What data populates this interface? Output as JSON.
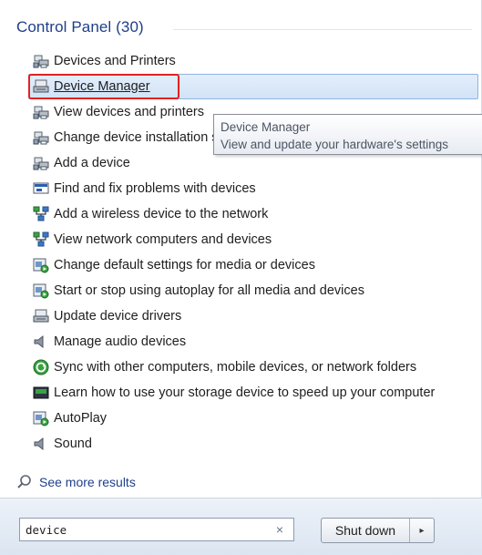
{
  "results": {
    "group_title": "Control Panel (30)",
    "items": [
      {
        "label": "Devices and Printers",
        "icon": "devices-printers-icon"
      },
      {
        "label": "Device Manager",
        "icon": "device-manager-icon"
      },
      {
        "label": "View devices and printers",
        "icon": "devices-printers-icon"
      },
      {
        "label": "Change device installation settings",
        "icon": "devices-printers-icon"
      },
      {
        "label": "Add a device",
        "icon": "devices-printers-icon"
      },
      {
        "label": "Find and fix problems with devices",
        "icon": "troubleshoot-icon"
      },
      {
        "label": "Add a wireless device to the network",
        "icon": "network-icon"
      },
      {
        "label": "View network computers and devices",
        "icon": "network-icon"
      },
      {
        "label": "Change default settings for media or devices",
        "icon": "autoplay-icon"
      },
      {
        "label": "Start or stop using autoplay for all media and devices",
        "icon": "autoplay-icon"
      },
      {
        "label": "Update device drivers",
        "icon": "device-manager-icon"
      },
      {
        "label": "Manage audio devices",
        "icon": "speaker-icon"
      },
      {
        "label": "Sync with other computers, mobile devices, or network folders",
        "icon": "sync-icon"
      },
      {
        "label": "Learn how to use your storage device to speed up your computer",
        "icon": "storage-icon"
      },
      {
        "label": "AutoPlay",
        "icon": "autoplay-icon"
      },
      {
        "label": "Sound",
        "icon": "speaker-icon"
      }
    ]
  },
  "tooltip": {
    "title": "Device Manager",
    "description": "View and update your hardware's settings"
  },
  "see_more": {
    "label": "See more results",
    "icon": "search-icon"
  },
  "search": {
    "value": "device",
    "clear_symbol": "×"
  },
  "shutdown": {
    "label": "Shut down",
    "arrow": "▸"
  },
  "colors": {
    "header_text": "#1e3f8a",
    "selection_fill": "#d2e3f7",
    "selection_border": "#8fb3e0",
    "annotation_box": "#e32121"
  }
}
